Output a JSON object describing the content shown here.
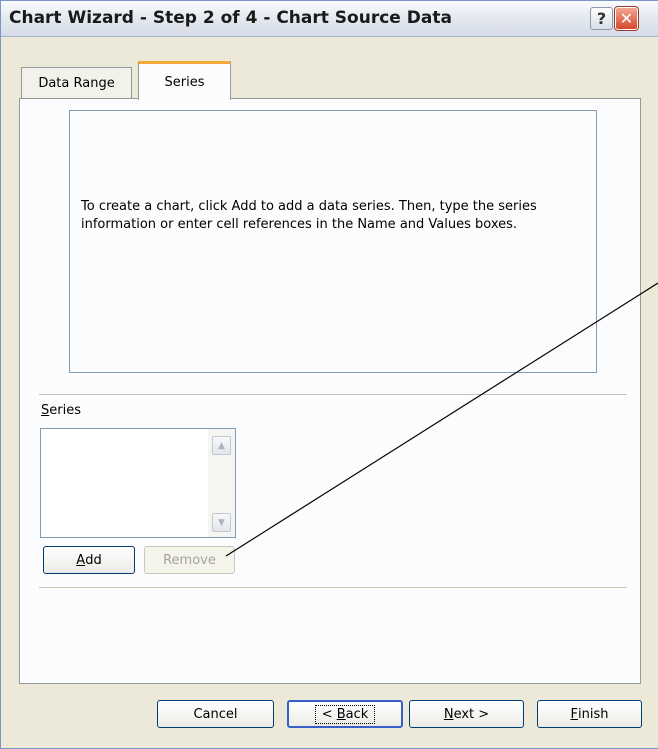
{
  "window": {
    "title": "Chart Wizard - Step 2 of 4 - Chart Source Data",
    "help_icon": "?",
    "close_icon": "✕"
  },
  "tabs": [
    {
      "label": "Data Range",
      "active": false
    },
    {
      "label": "Series",
      "active": true
    }
  ],
  "preview": {
    "text": "To create a chart, click Add to add a data series. Then, type the series information or enter cell references in the Name and Values boxes."
  },
  "series_section": {
    "label_first": "S",
    "label_rest": "eries",
    "items": [],
    "scroll_up_icon": "▲",
    "scroll_down_icon": "▼"
  },
  "buttons": {
    "add": {
      "mnemonic": "A",
      "rest": "dd",
      "enabled": true
    },
    "remove": {
      "label": "Remove",
      "enabled": false
    },
    "cancel": {
      "label": "Cancel"
    },
    "back": {
      "pre": "< ",
      "mnemonic": "B",
      "rest": "ack"
    },
    "next": {
      "mnemonic": "N",
      "rest": "ext >"
    },
    "finish": {
      "mnemonic": "F",
      "rest": "inish"
    }
  },
  "colors": {
    "dialog_bg": "#ece9d8",
    "active_tab_accent": "#f6a838",
    "close_button": "#d6482a"
  }
}
